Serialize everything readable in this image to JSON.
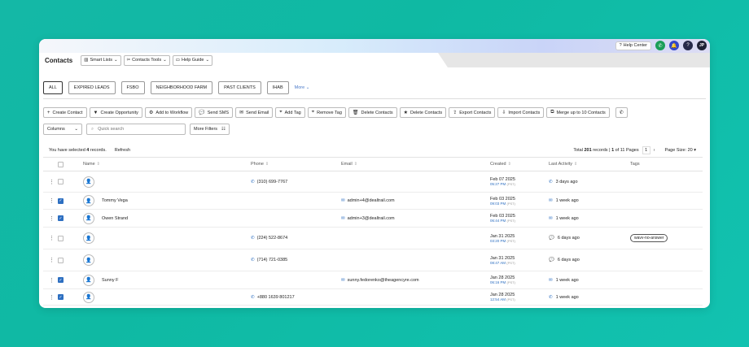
{
  "topbar": {
    "help_center": "Help Center",
    "user_initials": "JP"
  },
  "header": {
    "title": "Contacts",
    "menus": [
      {
        "label": "Smart Lists"
      },
      {
        "label": "Contacts Tools"
      },
      {
        "label": "Help Guide"
      }
    ]
  },
  "tabs": [
    "ALL",
    "EXPIRED LEADS",
    "FSBO",
    "NEIGHBORHOOD FARM",
    "PAST CLIENTS",
    "IHAB"
  ],
  "more_label": "More",
  "actions": [
    {
      "label": "Create Contact",
      "icon": "plus-icon"
    },
    {
      "label": "Create Opportunity",
      "icon": "funnel-icon"
    },
    {
      "label": "Add to Workflow",
      "icon": "workflow-icon"
    },
    {
      "label": "Send SMS",
      "icon": "chat-icon"
    },
    {
      "label": "Send Email",
      "icon": "mail-icon"
    },
    {
      "label": "Add Tag",
      "icon": "tag-icon"
    },
    {
      "label": "Remove Tag",
      "icon": "tag-icon"
    },
    {
      "label": "Delete Contacts",
      "icon": "trash-icon"
    },
    {
      "label": "Delete Contacts",
      "icon": "star-icon"
    },
    {
      "label": "Export Contacts",
      "icon": "export-icon"
    },
    {
      "label": "Import Contacts",
      "icon": "import-icon"
    },
    {
      "label": "Merge up to 10 Contacts",
      "icon": "merge-icon"
    }
  ],
  "filters": {
    "columns_label": "Columns",
    "search_placeholder": "Quick search",
    "more_filters": "More Filters"
  },
  "selection": {
    "prefix": "You have selected",
    "count": "4",
    "suffix": "records.",
    "refresh": "Refresh"
  },
  "pager": {
    "total_prefix": "Total",
    "total": "201",
    "records_word": "records",
    "page": "1",
    "of_pages": "of 11 Pages",
    "current": "1",
    "page_size_label": "Page Size: 20"
  },
  "table": {
    "columns": [
      "Name",
      "Phone",
      "Email",
      "Created",
      "Last Activity",
      "Tags"
    ],
    "rows": [
      {
        "checked": false,
        "name": "",
        "phone": "(310) 699-7767",
        "email": "",
        "created_date": "Feb 07 2025",
        "created_time": "05:27 PM",
        "tz": "(PST)",
        "activity": "3 days ago",
        "activity_icon": "phone-icon",
        "tag": ""
      },
      {
        "checked": true,
        "name": "Tommy Vega",
        "phone": "",
        "email": "admin+4@dealtrail.com",
        "created_date": "Feb 03 2025",
        "created_time": "09:03 PM",
        "tz": "(PST)",
        "activity": "1 week ago",
        "activity_icon": "mail-icon",
        "tag": ""
      },
      {
        "checked": true,
        "name": "Owen Strand",
        "phone": "",
        "email": "admin+3@dealtrail.com",
        "created_date": "Feb 03 2025",
        "created_time": "06:44 PM",
        "tz": "(PST)",
        "activity": "1 week ago",
        "activity_icon": "mail-icon",
        "tag": ""
      },
      {
        "checked": false,
        "name": "",
        "phone": "(224) 522-8674",
        "email": "",
        "created_date": "Jan 31 2025",
        "created_time": "03:20 PM",
        "tz": "(PST)",
        "activity": "6 days ago",
        "activity_icon": "chat-icon",
        "tag": "wavv-no-answer"
      },
      {
        "checked": false,
        "name": "",
        "phone": "(714) 721-0385",
        "email": "",
        "created_date": "Jan 31 2025",
        "created_time": "08:47 AM",
        "tz": "(PST)",
        "activity": "6 days ago",
        "activity_icon": "chat-icon",
        "tag": ""
      },
      {
        "checked": true,
        "name": "Sunny F",
        "phone": "",
        "email": "sunny.fedorenko@theagencyre.com",
        "created_date": "Jan 28 2025",
        "created_time": "06:16 PM",
        "tz": "(PST)",
        "activity": "1 week ago",
        "activity_icon": "mail-icon",
        "tag": ""
      },
      {
        "checked": true,
        "name": "",
        "phone": "+880 1639 801217",
        "email": "",
        "created_date": "Jan 28 2025",
        "created_time": "12:54 AM",
        "tz": "(PST)",
        "activity": "1 week ago",
        "activity_icon": "phone-icon",
        "tag": ""
      }
    ]
  },
  "colors": {
    "accent": "#2d6fc1",
    "background": "#14b8a6"
  }
}
